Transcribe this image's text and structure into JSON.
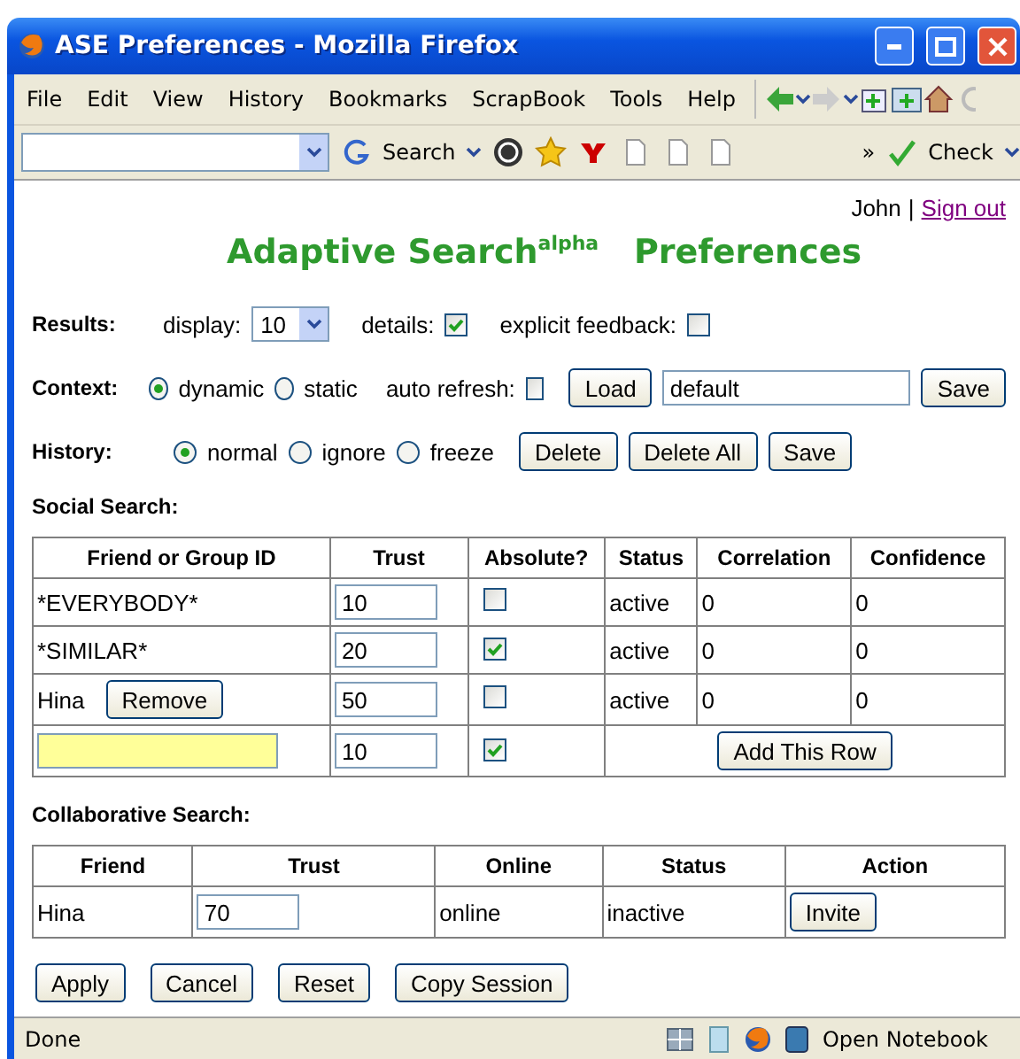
{
  "window": {
    "title": "ASE Preferences - Mozilla Firefox"
  },
  "menu": [
    "File",
    "Edit",
    "View",
    "History",
    "Bookmarks",
    "ScrapBook",
    "Tools",
    "Help"
  ],
  "toolbar": {
    "search_label": "Search",
    "more": "»",
    "check_label": "Check"
  },
  "user": {
    "name": "John",
    "separator": "|",
    "sign_out": "Sign out"
  },
  "heading": {
    "main": "Adaptive Search",
    "sup": "alpha",
    "rest": "Preferences"
  },
  "results": {
    "label": "Results:",
    "display_label": "display:",
    "display_value": "10",
    "details_label": "details:",
    "details_checked": true,
    "feedback_label": "explicit feedback:",
    "feedback_checked": false
  },
  "context": {
    "label": "Context:",
    "modes": [
      {
        "label": "dynamic",
        "selected": true
      },
      {
        "label": "static",
        "selected": false
      }
    ],
    "auto_refresh_label": "auto refresh:",
    "auto_refresh_checked": false,
    "load_button": "Load",
    "name_value": "default",
    "save_button": "Save"
  },
  "history": {
    "label": "History:",
    "modes": [
      {
        "label": "normal",
        "selected": true
      },
      {
        "label": "ignore",
        "selected": false
      },
      {
        "label": "freeze",
        "selected": false
      }
    ],
    "buttons": [
      "Delete",
      "Delete All",
      "Save"
    ]
  },
  "social": {
    "title": "Social Search:",
    "columns": [
      "Friend or Group ID",
      "Trust",
      "Absolute?",
      "Status",
      "Correlation",
      "Confidence"
    ],
    "rows": [
      {
        "id": "*EVERYBODY*",
        "trust": "10",
        "absolute": false,
        "status": "active",
        "correlation": "0",
        "confidence": "0"
      },
      {
        "id": "*SIMILAR*",
        "trust": "20",
        "absolute": true,
        "status": "active",
        "correlation": "0",
        "confidence": "0"
      },
      {
        "id": "Hina",
        "remove_button": "Remove",
        "trust": "50",
        "absolute": false,
        "status": "active",
        "correlation": "0",
        "confidence": "0"
      }
    ],
    "new_row": {
      "trust": "10",
      "absolute": true,
      "add_button": "Add This Row"
    }
  },
  "collab": {
    "title": "Collaborative Search:",
    "columns": [
      "Friend",
      "Trust",
      "Online",
      "Status",
      "Action"
    ],
    "rows": [
      {
        "friend": "Hina",
        "trust": "70",
        "online": "online",
        "status": "inactive",
        "action": "Invite"
      }
    ]
  },
  "actions": [
    "Apply",
    "Cancel",
    "Reset",
    "Copy Session"
  ],
  "status_bar": {
    "text": "Done",
    "notebook": "Open Notebook"
  }
}
